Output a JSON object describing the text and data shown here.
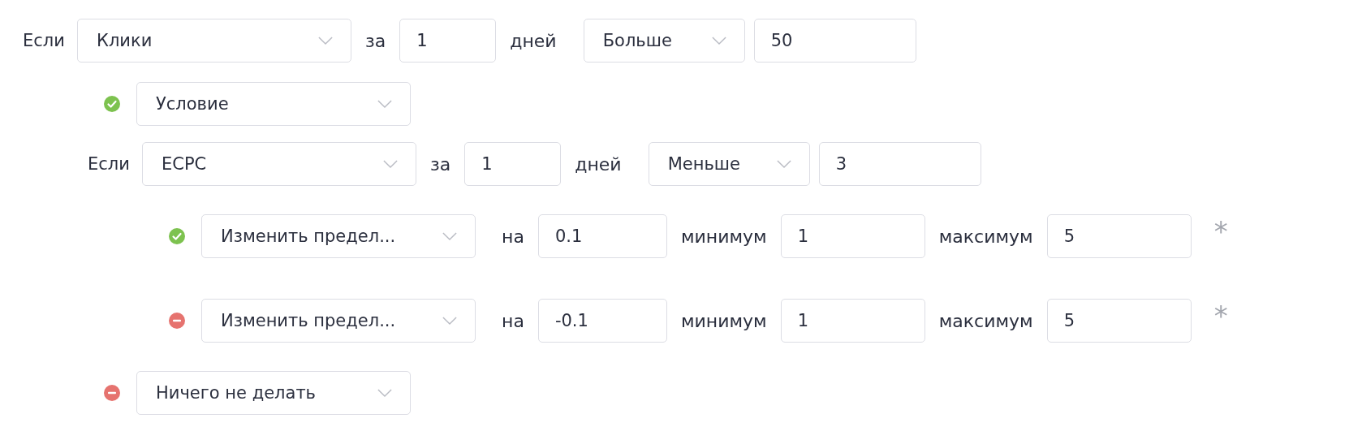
{
  "rule": {
    "if_label": "Если",
    "metric": "Клики",
    "period_label": "за",
    "period": "1",
    "unit": "дней",
    "comparison": "Больше",
    "threshold": "50",
    "branches": [
      {
        "kind": "check",
        "action": "Условие",
        "rule": {
          "if_label": "Если",
          "metric": "ECPC",
          "period_label": "за",
          "period": "1",
          "unit": "дней",
          "comparison": "Меньше",
          "threshold": "3",
          "branches": [
            {
              "kind": "check",
              "action": "Изменить предел...",
              "by_label": "на",
              "by": "0.1",
              "min_label": "минимум",
              "min": "1",
              "max_label": "максимум",
              "max": "5",
              "note": "*"
            },
            {
              "kind": "minus",
              "action": "Изменить предел...",
              "by_label": "на",
              "by": "-0.1",
              "min_label": "минимум",
              "min": "1",
              "max_label": "максимум",
              "max": "5",
              "note": "*"
            }
          ]
        }
      },
      {
        "kind": "minus",
        "action": "Ничего не делать"
      }
    ]
  }
}
